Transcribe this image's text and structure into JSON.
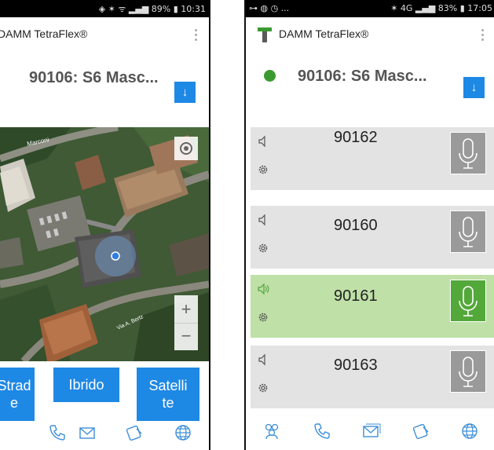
{
  "left_screen": {
    "status_bar": {
      "right_text": "◈ ✶ ᯤ ▂▄▆ 89% ▮ 10:31"
    },
    "app_title": "DAMM TetraFlex®",
    "radio_name": "90106: S6 Masc...",
    "map": {
      "street_labels": [
        "Marconi",
        "Via A. Bertz"
      ]
    },
    "map_type_buttons": [
      {
        "line1": "Strad",
        "line2": "e"
      },
      {
        "line1": "Ibrido",
        "line2": ""
      },
      {
        "line1": "Satelli",
        "line2": "te"
      }
    ],
    "zoom_in": "+",
    "zoom_out": "−"
  },
  "right_screen": {
    "status_bar": {
      "left_text": "⊶ ◍ ◷ ...",
      "right_text": "✶ 4G ▂▄▆ 83% ▮ 17:05"
    },
    "app_title": "DAMM TetraFlex®",
    "radio_name": "90106: S6 Masc...",
    "channels": [
      {
        "number": "90162",
        "active": false
      },
      {
        "number": "90160",
        "active": false
      },
      {
        "number": "90161",
        "active": true
      },
      {
        "number": "90163",
        "active": false
      }
    ]
  },
  "colors": {
    "accent_blue": "#1e88e5",
    "status_green": "#3a9a2f",
    "active_channel": "#bfe0a6",
    "inactive_channel": "#e3e3e3",
    "ptt_inactive": "#9a9a9a",
    "ptt_active": "#53a83a",
    "nav_icon": "#3d8fd8"
  }
}
